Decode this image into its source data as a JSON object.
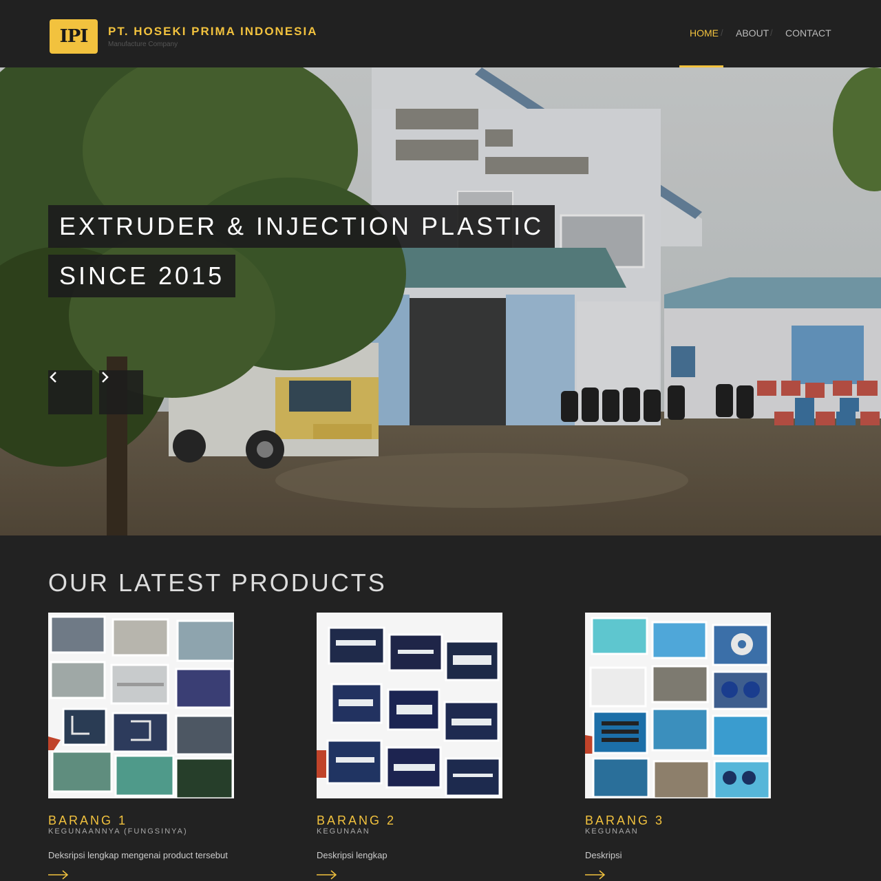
{
  "brand": {
    "logo_text": "IPI",
    "name": "PT. HOSEKI PRIMA INDONESIA",
    "tagline": "Manufacture Company"
  },
  "nav": {
    "items": [
      {
        "label": "HOME",
        "active": true
      },
      {
        "label": "ABOUT",
        "active": false
      },
      {
        "label": "CONTACT",
        "active": false
      }
    ],
    "separator": "/"
  },
  "hero": {
    "caption_line1": "EXTRUDER & INJECTION PLASTIC",
    "caption_line2": "SINCE 2015",
    "prev_icon": "chevron-left-icon",
    "next_icon": "chevron-right-icon"
  },
  "products": {
    "section_title": "OUR LATEST PRODUCTS",
    "items": [
      {
        "title": "BARANG 1",
        "subtitle": "KEGUNAANNYA (FUNGSINYA)",
        "description": "Deksripsi lengkap mengenai product tersebut",
        "link_icon": "arrow-right-icon"
      },
      {
        "title": "BARANG 2",
        "subtitle": "KEGUNAAN",
        "description": "Deskripsi lengkap",
        "link_icon": "arrow-right-icon"
      },
      {
        "title": "BARANG 3",
        "subtitle": "KEGUNAAN",
        "description": "Deskripsi",
        "link_icon": "arrow-right-icon"
      }
    ]
  },
  "colors": {
    "accent": "#f2c23e",
    "background": "#222222",
    "header": "#212121"
  }
}
